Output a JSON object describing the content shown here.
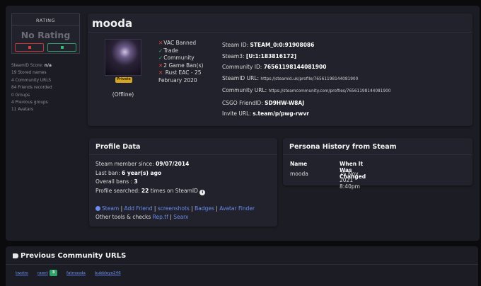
{
  "rating": {
    "header": "RATING",
    "value": "No Rating"
  },
  "sidebar_stats": {
    "steamid_score_label": "SteamID Score:",
    "steamid_score_value": "n/a",
    "lines": [
      "19 Stored names",
      "4 Community URLS",
      "84 Friends recorded",
      "0 Groups",
      "4 Previous groups",
      "11 Avatars"
    ]
  },
  "profile": {
    "name": "mooda",
    "private_badge": "Private",
    "status": "(Offline)",
    "bans": {
      "vac": "VAC Banned",
      "trade": "Trade",
      "community": "Community",
      "game_bans": "2 Game Ban(s)",
      "rust_eac": "Rust EAC - 25",
      "rust_eac_date": "February 2020"
    },
    "ids": {
      "steam_id_label": "Steam ID:",
      "steam_id": "STEAM_0:0:91908086",
      "steam3_label": "Steam3:",
      "steam3": "[U:1:183816172]",
      "community_id_label": "Community ID:",
      "community_id": "76561198144081900",
      "steamid_url_label": "SteamID URL:",
      "steamid_url": "https://steamid.uk/profile/76561198144081900",
      "community_url_label": "Community URL:",
      "community_url": "https://steamcommunity.com/profiles/76561198144081900",
      "csgo_label": "CSGO FriendID:",
      "csgo": "SD9HW-W8AJ",
      "invite_label": "Invite URL:",
      "invite": "s.team/p/pwg-rwvr"
    }
  },
  "profile_data": {
    "title": "Profile Data",
    "member_since_label": "Steam member since:",
    "member_since": "09/07/2014",
    "last_ban_label": "Last ban:",
    "last_ban": "6 year(s) ago",
    "overall_bans_label": "Overall bans :",
    "overall_bans": "3",
    "searched_label": "Profile searched:",
    "searched_count": "22",
    "searched_suffix": "times on SteamID",
    "links": {
      "steam": "Steam",
      "add_friend": "Add Friend",
      "screenshots": "screenshots",
      "badges": "Badges",
      "avatar_finder": "Avatar Finder",
      "sep": "|"
    },
    "other_tools_label": "Other tools & checks",
    "reptf": "Rep.tf",
    "searx": "Searx"
  },
  "persona_history": {
    "title": "Persona History from Steam",
    "col_name": "Name",
    "col_changed": "When It Was Changed",
    "rows": [
      {
        "name": "mooda",
        "changed": "25 Nov 2021 8:40pm"
      }
    ]
  },
  "previous_urls": {
    "title": "Previous Community URLS",
    "urls": [
      "twotm",
      "rawrt",
      "fatmooda",
      "bubbleye246"
    ],
    "badge": "3"
  },
  "colors": {
    "link": "#6c8cf0",
    "ban_x": "#e0463c",
    "ok_check": "#2fbf74",
    "private_badge": "#d7a61f"
  }
}
